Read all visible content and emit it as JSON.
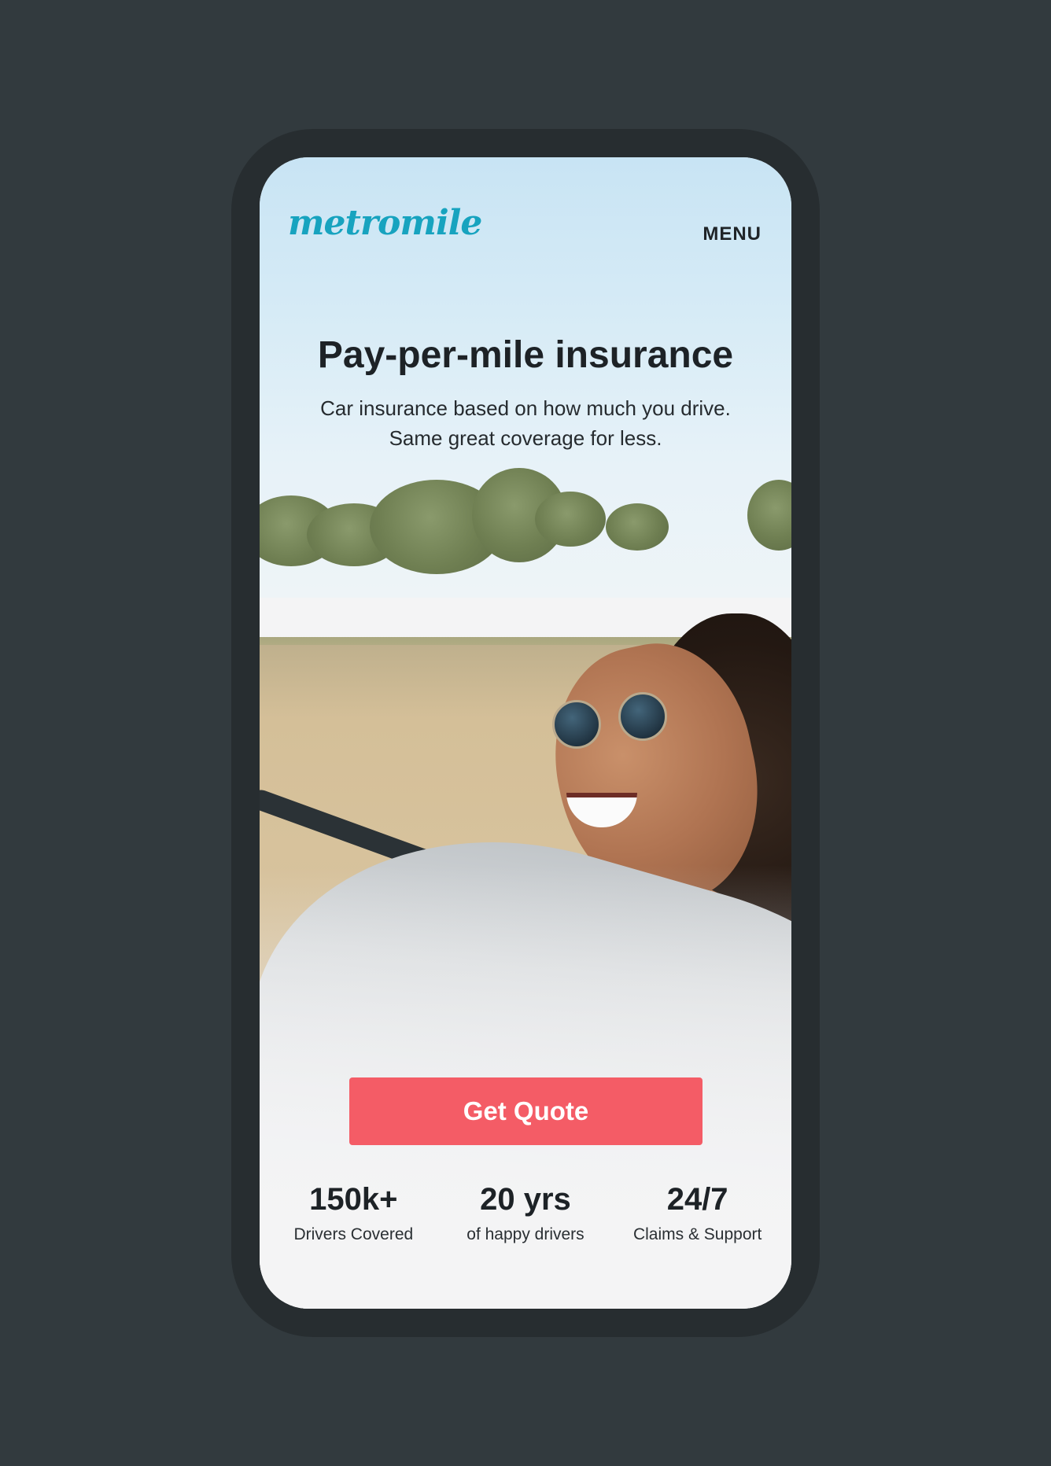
{
  "header": {
    "logo_text": "metromile",
    "menu_label": "MENU"
  },
  "hero": {
    "headline": "Pay-per-mile insurance",
    "subline_1": "Car insurance based on how much you drive.",
    "subline_2": "Same great coverage for less."
  },
  "cta": {
    "label": "Get Quote"
  },
  "stats": [
    {
      "value": "150k+",
      "label": "Drivers Covered"
    },
    {
      "value": "20 yrs",
      "label": "of happy drivers"
    },
    {
      "value": "24/7",
      "label": "Claims & Support"
    }
  ],
  "colors": {
    "brand": "#17a3bf",
    "cta": "#f45c66",
    "background": "#323a3e",
    "text": "#1d2226"
  }
}
